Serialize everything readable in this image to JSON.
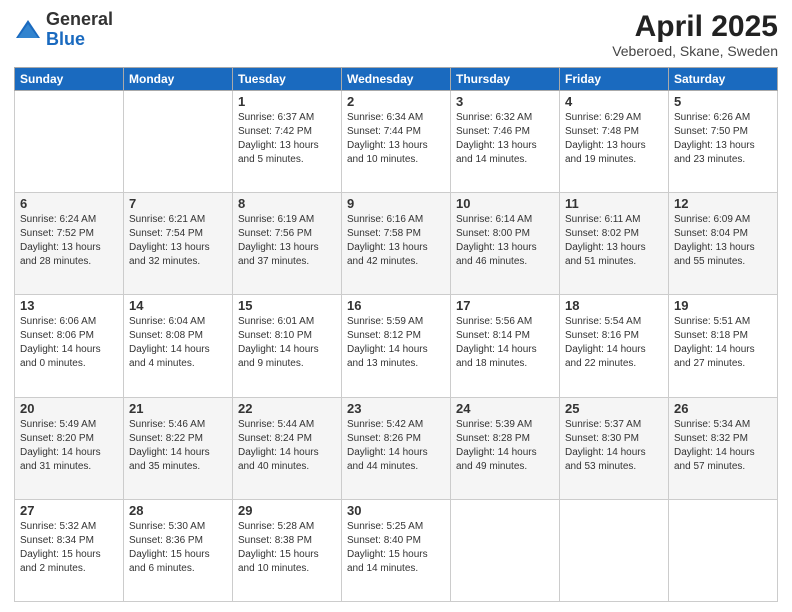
{
  "logo": {
    "general": "General",
    "blue": "Blue"
  },
  "title": "April 2025",
  "location": "Veberoed, Skane, Sweden",
  "weekdays": [
    "Sunday",
    "Monday",
    "Tuesday",
    "Wednesday",
    "Thursday",
    "Friday",
    "Saturday"
  ],
  "weeks": [
    [
      {
        "day": "",
        "info": ""
      },
      {
        "day": "",
        "info": ""
      },
      {
        "day": "1",
        "info": "Sunrise: 6:37 AM\nSunset: 7:42 PM\nDaylight: 13 hours\nand 5 minutes."
      },
      {
        "day": "2",
        "info": "Sunrise: 6:34 AM\nSunset: 7:44 PM\nDaylight: 13 hours\nand 10 minutes."
      },
      {
        "day": "3",
        "info": "Sunrise: 6:32 AM\nSunset: 7:46 PM\nDaylight: 13 hours\nand 14 minutes."
      },
      {
        "day": "4",
        "info": "Sunrise: 6:29 AM\nSunset: 7:48 PM\nDaylight: 13 hours\nand 19 minutes."
      },
      {
        "day": "5",
        "info": "Sunrise: 6:26 AM\nSunset: 7:50 PM\nDaylight: 13 hours\nand 23 minutes."
      }
    ],
    [
      {
        "day": "6",
        "info": "Sunrise: 6:24 AM\nSunset: 7:52 PM\nDaylight: 13 hours\nand 28 minutes."
      },
      {
        "day": "7",
        "info": "Sunrise: 6:21 AM\nSunset: 7:54 PM\nDaylight: 13 hours\nand 32 minutes."
      },
      {
        "day": "8",
        "info": "Sunrise: 6:19 AM\nSunset: 7:56 PM\nDaylight: 13 hours\nand 37 minutes."
      },
      {
        "day": "9",
        "info": "Sunrise: 6:16 AM\nSunset: 7:58 PM\nDaylight: 13 hours\nand 42 minutes."
      },
      {
        "day": "10",
        "info": "Sunrise: 6:14 AM\nSunset: 8:00 PM\nDaylight: 13 hours\nand 46 minutes."
      },
      {
        "day": "11",
        "info": "Sunrise: 6:11 AM\nSunset: 8:02 PM\nDaylight: 13 hours\nand 51 minutes."
      },
      {
        "day": "12",
        "info": "Sunrise: 6:09 AM\nSunset: 8:04 PM\nDaylight: 13 hours\nand 55 minutes."
      }
    ],
    [
      {
        "day": "13",
        "info": "Sunrise: 6:06 AM\nSunset: 8:06 PM\nDaylight: 14 hours\nand 0 minutes."
      },
      {
        "day": "14",
        "info": "Sunrise: 6:04 AM\nSunset: 8:08 PM\nDaylight: 14 hours\nand 4 minutes."
      },
      {
        "day": "15",
        "info": "Sunrise: 6:01 AM\nSunset: 8:10 PM\nDaylight: 14 hours\nand 9 minutes."
      },
      {
        "day": "16",
        "info": "Sunrise: 5:59 AM\nSunset: 8:12 PM\nDaylight: 14 hours\nand 13 minutes."
      },
      {
        "day": "17",
        "info": "Sunrise: 5:56 AM\nSunset: 8:14 PM\nDaylight: 14 hours\nand 18 minutes."
      },
      {
        "day": "18",
        "info": "Sunrise: 5:54 AM\nSunset: 8:16 PM\nDaylight: 14 hours\nand 22 minutes."
      },
      {
        "day": "19",
        "info": "Sunrise: 5:51 AM\nSunset: 8:18 PM\nDaylight: 14 hours\nand 27 minutes."
      }
    ],
    [
      {
        "day": "20",
        "info": "Sunrise: 5:49 AM\nSunset: 8:20 PM\nDaylight: 14 hours\nand 31 minutes."
      },
      {
        "day": "21",
        "info": "Sunrise: 5:46 AM\nSunset: 8:22 PM\nDaylight: 14 hours\nand 35 minutes."
      },
      {
        "day": "22",
        "info": "Sunrise: 5:44 AM\nSunset: 8:24 PM\nDaylight: 14 hours\nand 40 minutes."
      },
      {
        "day": "23",
        "info": "Sunrise: 5:42 AM\nSunset: 8:26 PM\nDaylight: 14 hours\nand 44 minutes."
      },
      {
        "day": "24",
        "info": "Sunrise: 5:39 AM\nSunset: 8:28 PM\nDaylight: 14 hours\nand 49 minutes."
      },
      {
        "day": "25",
        "info": "Sunrise: 5:37 AM\nSunset: 8:30 PM\nDaylight: 14 hours\nand 53 minutes."
      },
      {
        "day": "26",
        "info": "Sunrise: 5:34 AM\nSunset: 8:32 PM\nDaylight: 14 hours\nand 57 minutes."
      }
    ],
    [
      {
        "day": "27",
        "info": "Sunrise: 5:32 AM\nSunset: 8:34 PM\nDaylight: 15 hours\nand 2 minutes."
      },
      {
        "day": "28",
        "info": "Sunrise: 5:30 AM\nSunset: 8:36 PM\nDaylight: 15 hours\nand 6 minutes."
      },
      {
        "day": "29",
        "info": "Sunrise: 5:28 AM\nSunset: 8:38 PM\nDaylight: 15 hours\nand 10 minutes."
      },
      {
        "day": "30",
        "info": "Sunrise: 5:25 AM\nSunset: 8:40 PM\nDaylight: 15 hours\nand 14 minutes."
      },
      {
        "day": "",
        "info": ""
      },
      {
        "day": "",
        "info": ""
      },
      {
        "day": "",
        "info": ""
      }
    ]
  ]
}
